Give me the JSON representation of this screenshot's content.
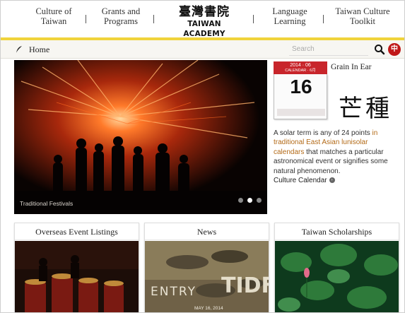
{
  "nav": {
    "items": [
      "Culture of\nTaiwan",
      "Grants and\nPrograms",
      "Language\nLearning",
      "Taiwan Culture\nToolkit"
    ],
    "logo_cn": "臺灣書院",
    "logo_en": "TAIWAN ACADEMY"
  },
  "subbar": {
    "home_label": "Home",
    "search_placeholder": "Search",
    "lang_label": "中"
  },
  "hero": {
    "caption": "Traditional Festivals",
    "active_slide": 2,
    "slide_count": 3
  },
  "calendar": {
    "top_line": "2014 · 06",
    "top_sub": "CALENDAR · 6月",
    "day": "16",
    "term_title": "Grain In Ear",
    "term_cn": "芒種",
    "desc_plain_1": "A solar term is any of 24 points ",
    "desc_hl_1": "in traditional East Asian lunisolar calendars",
    "desc_plain_2": " that matches a particular astronomical event or signifies some natural phenomenon.",
    "link_label": "Culture Calendar"
  },
  "cards": [
    {
      "title": "Overseas Event Listings"
    },
    {
      "title": "News"
    },
    {
      "title": "Taiwan Scholarships"
    }
  ],
  "news_poster": {
    "text_1": "ENTRY",
    "text_2": "TIDF",
    "date": "MAY 16, 2014"
  },
  "colors": {
    "accent_yellow": "#f0d33c",
    "brand_red": "#c01818",
    "link_orange": "#b36a17"
  }
}
